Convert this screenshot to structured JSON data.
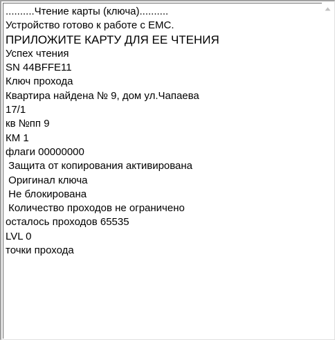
{
  "log": {
    "lines": [
      "..........Чтение карты (ключа)..........",
      "Устройство готово к работе с ЕМС.",
      "ПРИЛОЖИТЕ КАРТУ ДЛЯ ЕЕ ЧТЕНИЯ",
      "Успех чтения",
      "SN 44BFFE11",
      "Ключ прохода",
      "Квартира найдена № 9, дом ул.Чапаева",
      "17/1",
      "кв №пп 9",
      "КМ 1",
      "флаги 00000000",
      " Защита от копирования активирована",
      " Оригинал ключа",
      " Не блокирована",
      " Количество проходов не ограничено",
      "осталось проходов 65535",
      "LVL 0",
      "точки прохода"
    ]
  },
  "scrollbar": {
    "up_icon": "triangle-up-icon",
    "arrow_color": "#c0c0c0"
  }
}
